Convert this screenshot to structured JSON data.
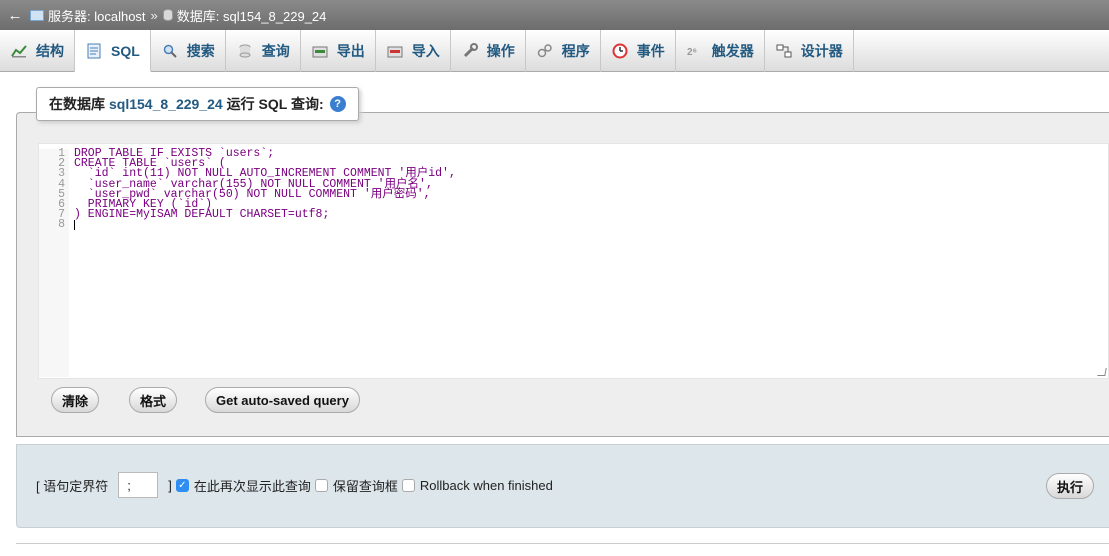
{
  "breadcrumb": {
    "back": "←",
    "server_label": "服务器: localhost",
    "separator": "»",
    "db_label": "数据库: sql154_8_229_24"
  },
  "tabs": [
    {
      "label": "结构",
      "icon": "chart-icon"
    },
    {
      "label": "SQL",
      "icon": "sql-page-icon"
    },
    {
      "label": "搜索",
      "icon": "search-icon"
    },
    {
      "label": "查询",
      "icon": "query-icon"
    },
    {
      "label": "导出",
      "icon": "export-icon"
    },
    {
      "label": "导入",
      "icon": "import-icon"
    },
    {
      "label": "操作",
      "icon": "wrench-icon"
    },
    {
      "label": "程序",
      "icon": "routines-icon"
    },
    {
      "label": "事件",
      "icon": "clock-icon"
    },
    {
      "label": "触发器",
      "icon": "trigger-icon"
    },
    {
      "label": "设计器",
      "icon": "designer-icon"
    }
  ],
  "legend": {
    "prefix": "在数据库",
    "dbname": "sql154_8_229_24",
    "suffix": "运行 SQL 查询:"
  },
  "editor": {
    "line_numbers": [
      "1",
      "2",
      "3",
      "4",
      "5",
      "6",
      "7",
      "8"
    ],
    "lines": [
      "DROP TABLE IF EXISTS `users`;",
      "CREATE TABLE `users` (",
      "  `id` int(11) NOT NULL AUTO_INCREMENT COMMENT '用户id',",
      "  `user_name` varchar(155) NOT NULL COMMENT '用户名',",
      "  `user_pwd` varchar(50) NOT NULL COMMENT '用户密码',",
      "  PRIMARY KEY (`id`)",
      ") ENGINE=MyISAM DEFAULT CHARSET=utf8;",
      ""
    ]
  },
  "buttons": {
    "clear": "清除",
    "format": "格式",
    "autosaved": "Get auto-saved query",
    "go": "执行"
  },
  "options": {
    "delimiter_label_open": "[ 语句定界符",
    "delimiter_value": ";",
    "delimiter_label_close": "]",
    "show_again_label": "在此再次显示此查询",
    "retain_box_label": "保留查询框",
    "rollback_label": "Rollback when finished"
  }
}
